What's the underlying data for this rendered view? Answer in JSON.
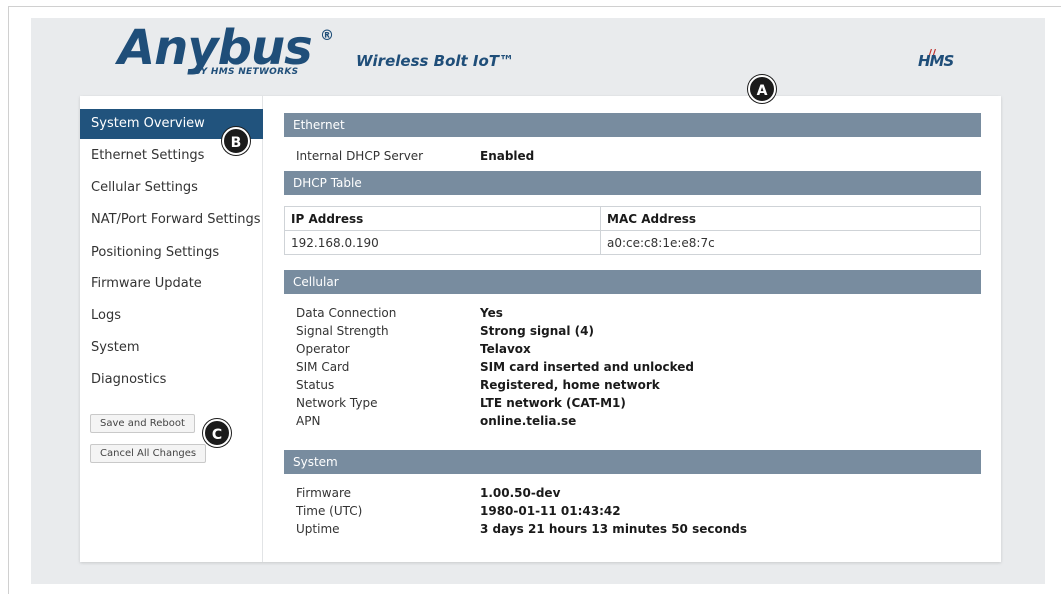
{
  "header": {
    "logo_text": "Anybus",
    "logo_reg": "®",
    "logo_sub": "BY HMS NETWORKS",
    "product": "Wireless Bolt IoT™",
    "hms_logo": "HMS"
  },
  "sidebar": {
    "items": [
      {
        "label": "System Overview",
        "active": true
      },
      {
        "label": "Ethernet Settings"
      },
      {
        "label": "Cellular Settings"
      },
      {
        "label": "NAT/Port Forward Settings"
      },
      {
        "label": "Positioning Settings"
      },
      {
        "label": "Firmware Update"
      },
      {
        "label": "Logs"
      },
      {
        "label": "System"
      },
      {
        "label": "Diagnostics"
      }
    ],
    "save_reboot": "Save and Reboot",
    "cancel_all": "Cancel All Changes"
  },
  "ethernet": {
    "title": "Ethernet",
    "dhcp_label": "Internal DHCP Server",
    "dhcp_value": "Enabled"
  },
  "dhcp_table": {
    "title": "DHCP Table",
    "headers": [
      "IP Address",
      "MAC Address"
    ],
    "rows": [
      [
        "192.168.0.190",
        "a0:ce:c8:1e:e8:7c"
      ]
    ]
  },
  "cellular": {
    "title": "Cellular",
    "rows": [
      {
        "label": "Data Connection",
        "value": "Yes"
      },
      {
        "label": "Signal Strength",
        "value": "Strong signal (4)"
      },
      {
        "label": "Operator",
        "value": "Telavox"
      },
      {
        "label": "SIM Card",
        "value": "SIM card inserted and unlocked"
      },
      {
        "label": "Status",
        "value": "Registered, home network"
      },
      {
        "label": "Network Type",
        "value": "LTE network (CAT-M1)"
      },
      {
        "label": "APN",
        "value": "online.telia.se"
      }
    ]
  },
  "system": {
    "title": "System",
    "rows": [
      {
        "label": "Firmware",
        "value": "1.00.50-dev"
      },
      {
        "label": "Time (UTC)",
        "value": "1980-01-11 01:43:42"
      },
      {
        "label": "Uptime",
        "value": "3 days 21 hours 13 minutes 50 seconds"
      }
    ]
  },
  "callouts": {
    "a": "A",
    "b": "B",
    "c": "C"
  },
  "colors": {
    "brand": "#1f4e79",
    "nav_active": "#21537d",
    "section_bar": "#788c9f"
  }
}
